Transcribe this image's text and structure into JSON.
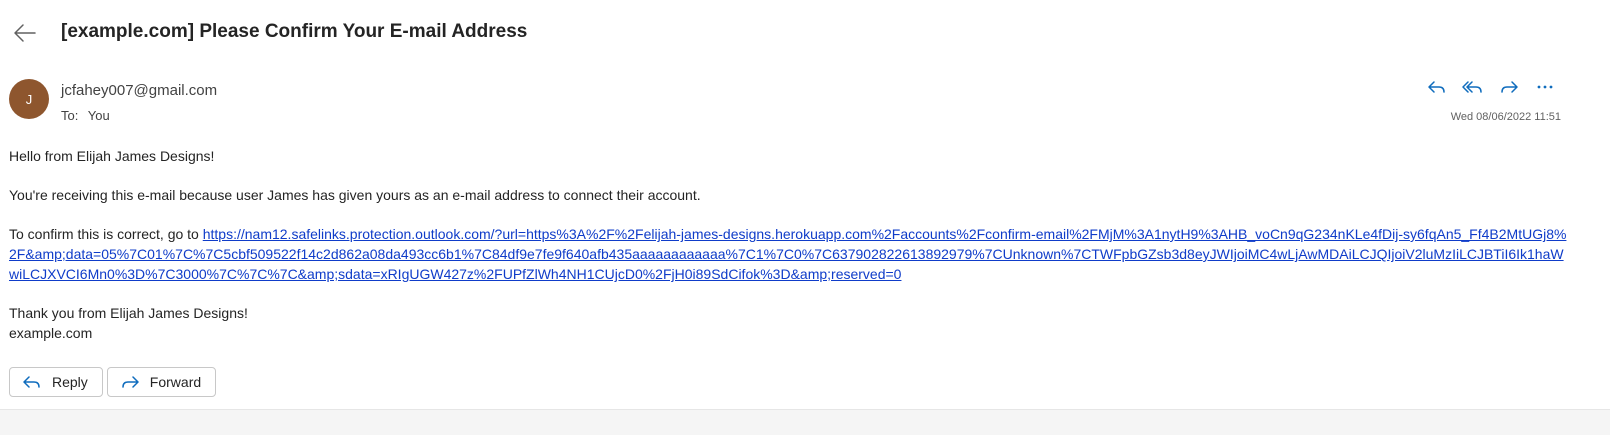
{
  "message": {
    "subject": "[example.com] Please Confirm Your E-mail Address",
    "sender_initial": "J",
    "sender_email": "jcfahey007@gmail.com",
    "to_label": "To:",
    "to_value": "You",
    "date": "Wed 08/06/2022 11:51",
    "avatar_color": "#8e562e"
  },
  "actions": {
    "reply_icon": "reply-icon",
    "reply_all_icon": "reply-all-icon",
    "forward_icon": "forward-icon",
    "more_icon": "more-icon"
  },
  "body": {
    "greeting": "Hello from Elijah James Designs!",
    "reason": "You're receiving this e-mail because user James has given yours as an e-mail address to connect their account.",
    "confirm_prefix": "To confirm this is correct, go to ",
    "confirm_link": "https://nam12.safelinks.protection.outlook.com/?url=https%3A%2F%2Felijah-james-designs.herokuapp.com%2Faccounts%2Fconfirm-email%2FMjM%3A1nytH9%3AHB_voCn9qG234nKLe4fDij-sy6fqAn5_Ff4B2MtUGj8%2F&amp;data=05%7C01%7C%7C5cbf509522f14c2d862a08da493cc6b1%7C84df9e7fe9f640afb435aaaaaaaaaaaa%7C1%7C0%7C637902822613892979%7CUnknown%7CTWFpbGZsb3d8eyJWIjoiMC4wLjAwMDAiLCJQIjoiV2luMzIiLCJBTiI6Ik1haWwiLCJXVCI6Mn0%3D%7C3000%7C%7C%7C&amp;sdata=xRIgUGW427z%2FUPfZlWh4NH1CUjcD0%2FjH0i89SdCifok%3D&amp;reserved=0",
    "thanks": "Thank you from Elijah James Designs!",
    "signature": "example.com"
  },
  "buttons": {
    "reply_label": "Reply",
    "forward_label": "Forward"
  },
  "colors": {
    "accent": "#0f6cbd",
    "link": "#0f3cc9"
  }
}
